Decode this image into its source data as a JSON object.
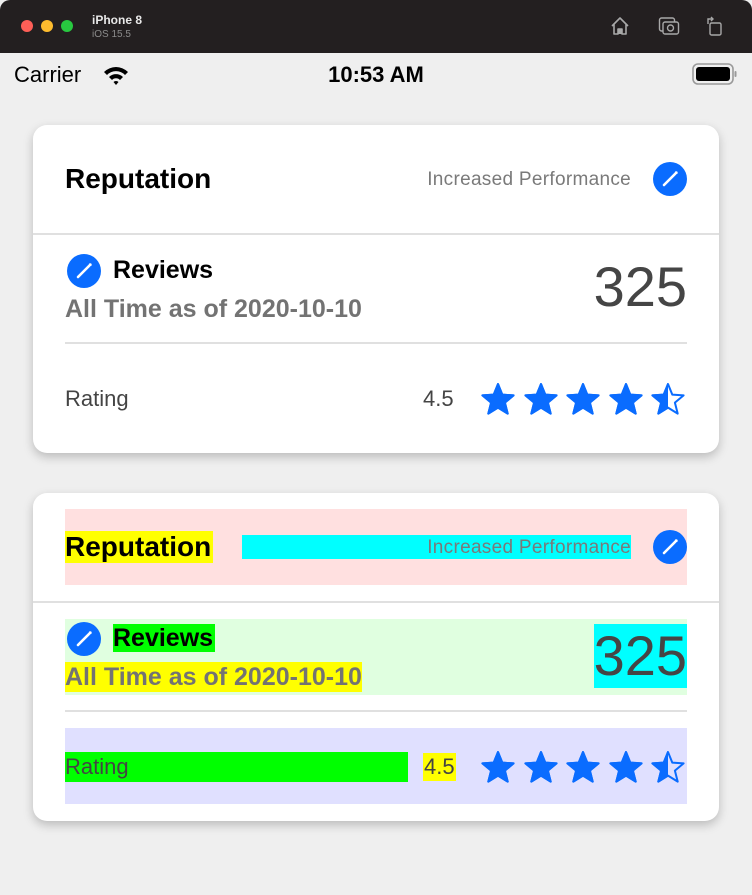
{
  "simulator": {
    "device_name": "iPhone 8",
    "os_version": "iOS 15.5",
    "toolbar_icons": [
      "home-icon",
      "screenshot-icon",
      "rotate-icon"
    ]
  },
  "status_bar": {
    "carrier": "Carrier",
    "time": "10:53 AM",
    "wifi": "wifi-icon",
    "battery": "battery-icon"
  },
  "accent_color": "#0a6cff",
  "cards": [
    {
      "title": "Reputation",
      "subtitle": "Increased Performance",
      "reviews": {
        "label": "Reviews",
        "period": "All Time as of 2020-10-10",
        "count": "325"
      },
      "rating": {
        "label": "Rating",
        "value": "4.5",
        "stars": 4.5,
        "max_stars": 5
      }
    },
    {
      "title": "Reputation",
      "subtitle": "Increased Performance",
      "reviews": {
        "label": "Reviews",
        "period": "All Time as of 2020-10-10",
        "count": "325"
      },
      "rating": {
        "label": "Rating",
        "value": "4.5",
        "stars": 4.5,
        "max_stars": 5
      },
      "debug_colors": {
        "header_row": "#ffe0e0",
        "title": "#ffff00",
        "subtitle": "#00ffff",
        "reviews_row": "#e0ffe0",
        "reviews_label": "#00ff00",
        "reviews_period": "#ffff00",
        "reviews_count": "#00ffff",
        "rating_row": "#e0e0ff",
        "rating_label": "#00ff00",
        "rating_value": "#ffff00"
      }
    }
  ]
}
